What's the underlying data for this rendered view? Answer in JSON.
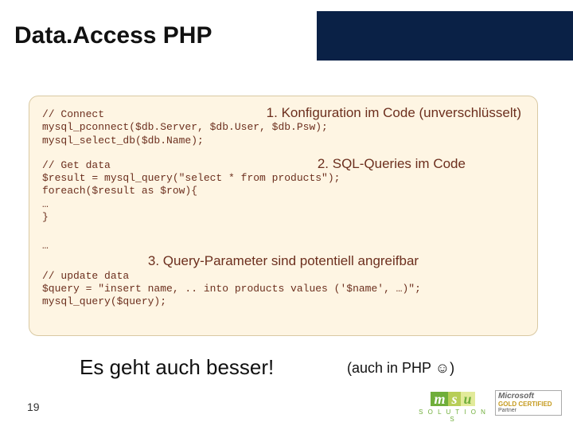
{
  "header": {
    "title": "Data.Access PHP"
  },
  "code": {
    "line1_comment": "// Connect",
    "annot1": "1. Konfiguration im Code (unverschlüsselt)",
    "line2": "mysql_pconnect($db.Server, $db.User, $db.Psw);",
    "line3": "mysql_select_db($db.Name);",
    "line4_comment": "// Get data",
    "annot2": "2. SQL-Queries im Code",
    "line5": "$result = mysql_query(\"select * from products\");",
    "line6": "foreach($result as $row){",
    "line7": "    …",
    "line8": "}",
    "line9": "…",
    "annot3": "3. Query-Parameter sind potentiell angreifbar",
    "line10_comment": "// update data",
    "line11": "$query = \"insert name, .. into products values ('$name', …)\";",
    "line12": "mysql_query($query);"
  },
  "footer": {
    "statement": "Es geht auch besser!",
    "aside": "(auch in PHP ☺)",
    "page": "19",
    "msu_sub": "S O L U T I O N S",
    "ms_brand": "Microsoft",
    "ms_cert1": "GOLD CERTIFIED",
    "ms_cert2": "Partner"
  }
}
